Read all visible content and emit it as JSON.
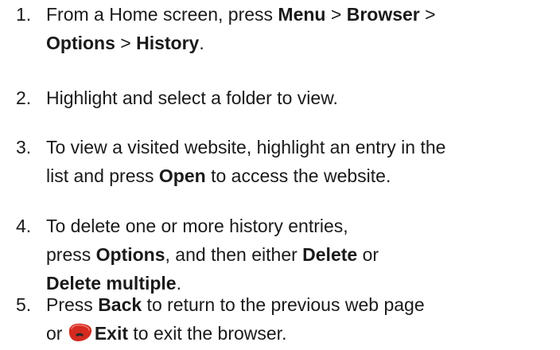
{
  "steps": [
    {
      "num": "1.",
      "line1": {
        "t1": "From a Home screen, press ",
        "b1": "Menu",
        "t2": " > ",
        "b2": "Browser",
        "t3": " >"
      },
      "line2": {
        "b1": "Options",
        "t1": " > ",
        "b2": "History",
        "t2": "."
      }
    },
    {
      "num": "2.",
      "line1": {
        "t1": "Highlight and select a folder to view."
      }
    },
    {
      "num": "3.",
      "line1": {
        "t1": "To view a visited website, highlight an entry in the"
      },
      "line2": {
        "t1": "list and press ",
        "b1": "Open",
        "t2": " to access the website."
      }
    },
    {
      "num": "4.",
      "line1": {
        "t1": "To delete one or more history entries,"
      },
      "line2": {
        "t1": "press ",
        "b1": "Options",
        "t2": ", and then either ",
        "b2": "Delete",
        "t3": " or"
      },
      "line3": {
        "b1": "Delete multiple",
        "t1": "."
      }
    },
    {
      "num": "5.",
      "line1": {
        "t1": "Press ",
        "b1": "Back",
        "t2": " to return to the previous web page"
      },
      "line2": {
        "t1": "or ",
        "icon": "end-call-key-icon",
        "b1": "Exit",
        "t2": " to exit the browser."
      }
    }
  ],
  "colors": {
    "text": "#1a1a1a",
    "end_key_red": "#d42a20"
  }
}
